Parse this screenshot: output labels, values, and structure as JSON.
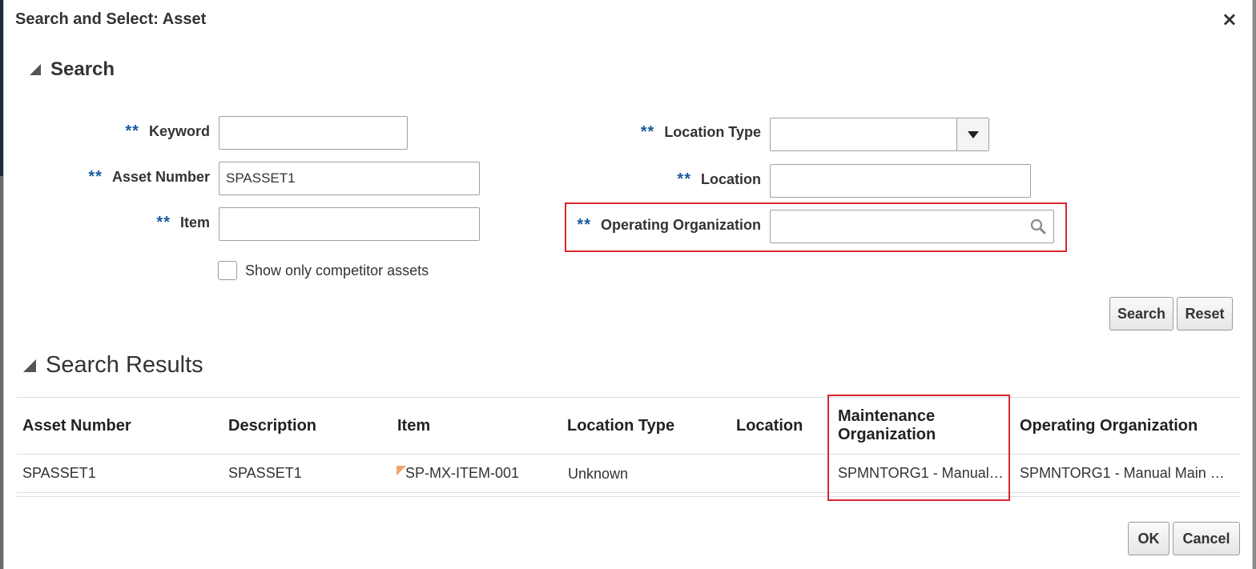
{
  "dialog": {
    "title": "Search and Select: Asset",
    "close_glyph": "×"
  },
  "search": {
    "section_title": "Search",
    "required_marker": "**",
    "keyword": {
      "label": "Keyword",
      "value": ""
    },
    "asset_number": {
      "label": "Asset Number",
      "value": "SPASSET1"
    },
    "item": {
      "label": "Item",
      "value": ""
    },
    "location_type": {
      "label": "Location Type",
      "value": ""
    },
    "location": {
      "label": "Location",
      "value": ""
    },
    "operating_organization": {
      "label": "Operating Organization",
      "value": ""
    },
    "competitor_checkbox": {
      "label": "Show only competitor assets",
      "checked": false
    },
    "search_button": "Search",
    "reset_button": "Reset"
  },
  "results": {
    "section_title": "Search Results",
    "columns": [
      "Asset Number",
      "Description",
      "Item",
      "Location Type",
      "Location",
      "Maintenance Organization",
      "Operating Organization"
    ],
    "rows": [
      {
        "asset_number": "SPASSET1",
        "description": "SPASSET1",
        "item": "SP-MX-ITEM-001",
        "location_type": "Unknown",
        "location": "",
        "maintenance_organization": "SPMNTORG1 - Manual…",
        "operating_organization": "SPMNTORG1 - Manual Main …"
      }
    ]
  },
  "footer": {
    "ok_button": "OK",
    "cancel_button": "Cancel"
  },
  "colors": {
    "required_marker": "#1a5a9e",
    "highlight": "#d9262f",
    "item_flag": "#f2a36b"
  }
}
